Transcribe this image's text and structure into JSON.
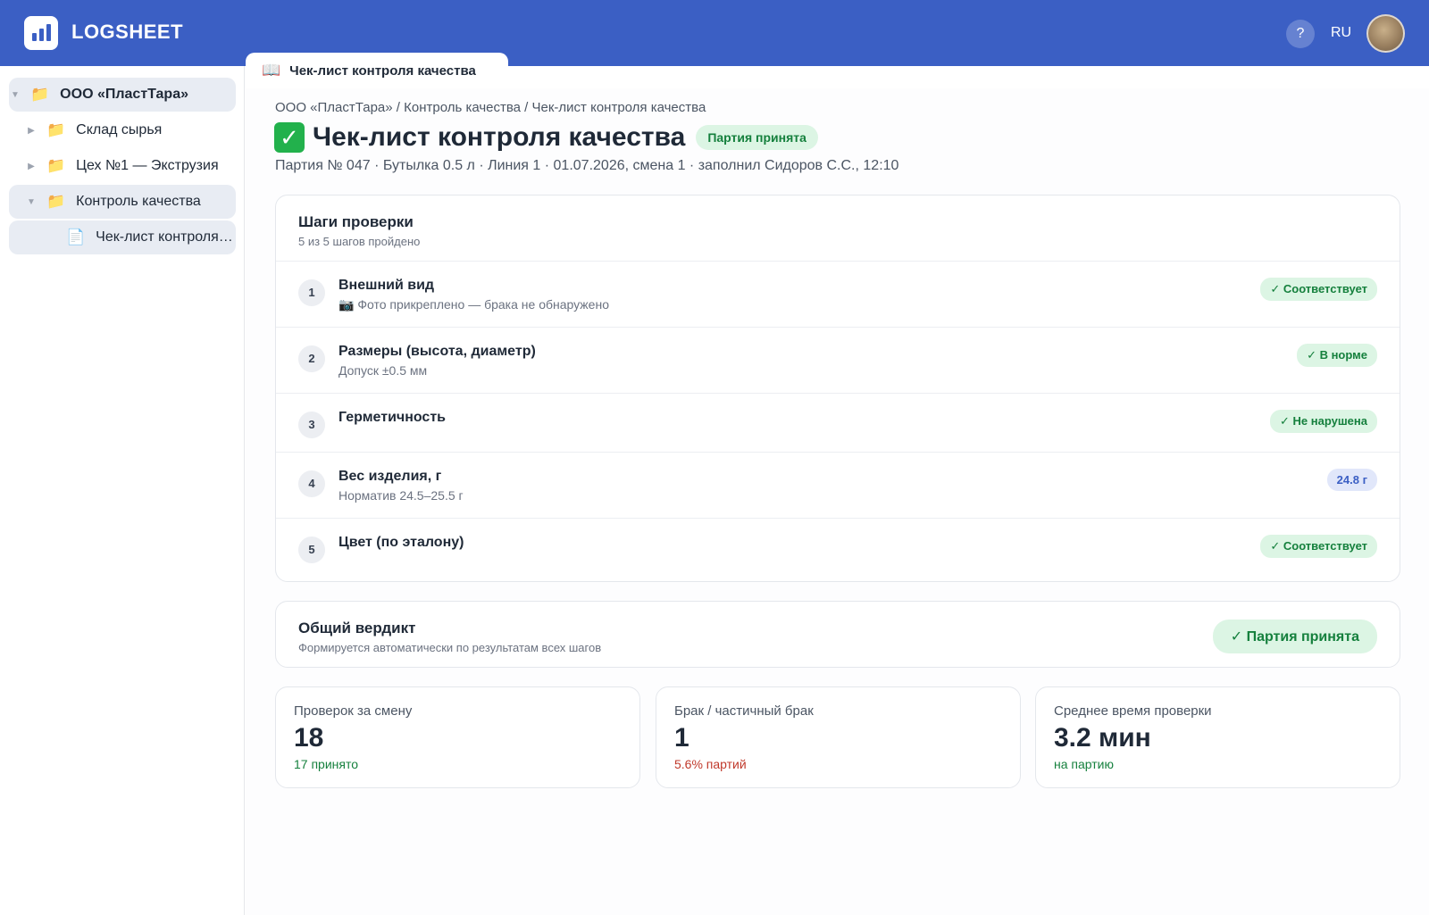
{
  "header": {
    "brand": "LOGSHEET",
    "help_label": "?",
    "lang": "RU",
    "colors": {
      "bar": "#3b5fc4"
    }
  },
  "sidebar": {
    "items": [
      {
        "label": "ООО «ПластТара»",
        "caret": "▼",
        "icon": "folder-icon"
      },
      {
        "label": "Склад сырья",
        "caret": "▶",
        "icon": "folder-icon"
      },
      {
        "label": "Цех №1 — Экструзия",
        "caret": "▶",
        "icon": "folder-icon"
      },
      {
        "label": "Контроль качества",
        "caret": "▼",
        "icon": "folder-icon"
      },
      {
        "label": "Чек-лист контроля качества",
        "caret": "",
        "icon": "document-icon"
      }
    ]
  },
  "tab": {
    "label": "Чек-лист контроля качества",
    "icon": "book-icon"
  },
  "page": {
    "breadcrumb": "ООО «ПластТара» / Контроль качества / Чек-лист контроля качества",
    "title": "Чек-лист контроля качества",
    "title_icon": "check-mark-icon",
    "status": "Партия принята",
    "meta": "Партия № 047 · Бутылка 0.5 л · Линия 1 · 01.07.2026, смена 1 · заполнил Сидоров С.С., 12:10"
  },
  "steps": {
    "title": "Шаги проверки",
    "subtitle": "5 из 5 шагов пройдено",
    "items": [
      {
        "num": "1",
        "name": "Внешний вид",
        "note": "📷 Фото прикреплено — брака не обнаружено",
        "badge": "✓ Соответствует",
        "badge_color": "green"
      },
      {
        "num": "2",
        "name": "Размеры (высота, диаметр)",
        "note": "Допуск ±0.5 мм",
        "badge": "✓ В норме",
        "badge_color": "green"
      },
      {
        "num": "3",
        "name": "Герметичность",
        "note": "",
        "badge": "✓ Не нарушена",
        "badge_color": "green"
      },
      {
        "num": "4",
        "name": "Вес изделия, г",
        "note": "Норматив 24.5–25.5 г",
        "badge": "24.8 г",
        "badge_color": "blue"
      },
      {
        "num": "5",
        "name": "Цвет (по эталону)",
        "note": "",
        "badge": "✓ Соответствует",
        "badge_color": "green"
      }
    ]
  },
  "verdict": {
    "title": "Общий вердикт",
    "subtitle": "Формируется автоматически по результатам всех шагов",
    "value": "✓ Партия принята"
  },
  "stats": [
    {
      "label": "Проверок за смену",
      "value": "18",
      "sub": "17 принято",
      "sub_color": "green"
    },
    {
      "label": "Брак / частичный брак",
      "value": "1",
      "sub": "5.6% партий",
      "sub_color": "red"
    },
    {
      "label": "Среднее время проверки",
      "value": "3.2 мин",
      "sub": "на партию",
      "sub_color": "green"
    }
  ]
}
